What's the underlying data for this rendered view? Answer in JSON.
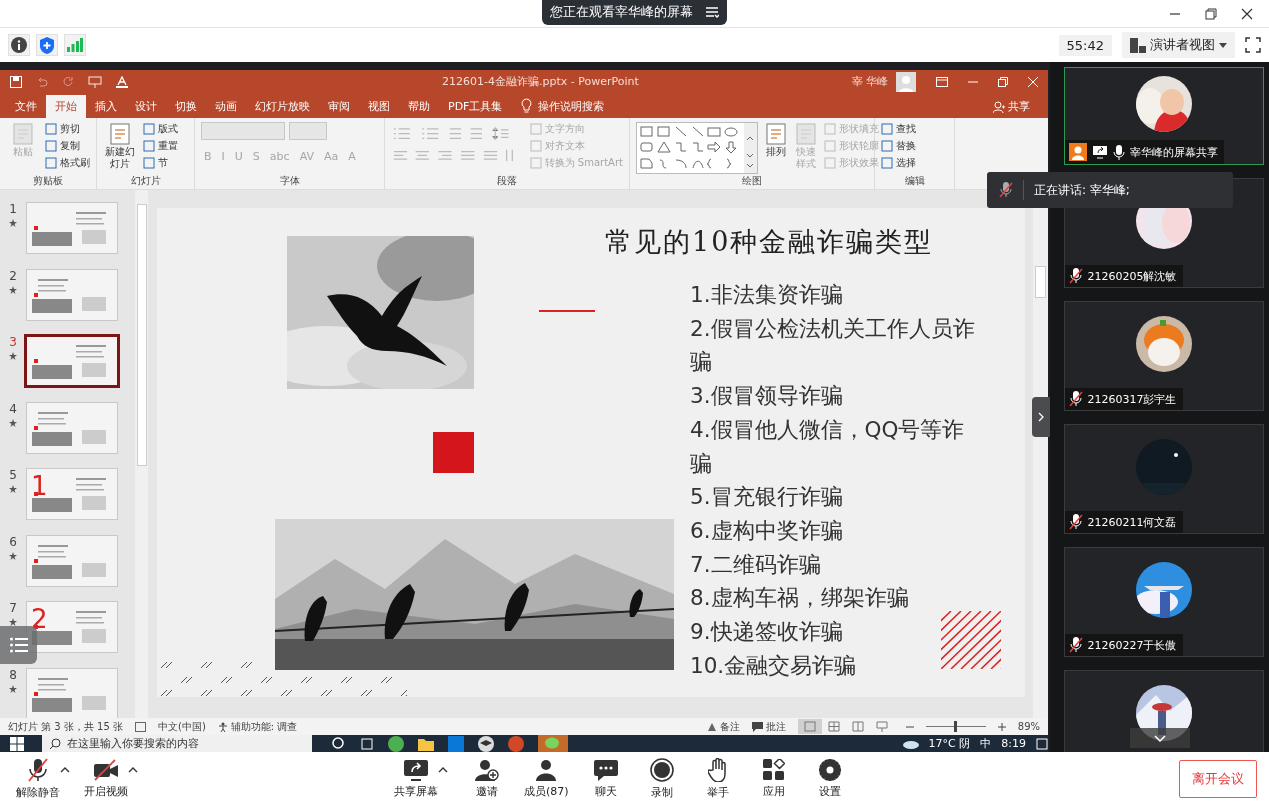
{
  "banner": {
    "text": "您正在观看宰华峰的屏幕"
  },
  "toolbar": {
    "timer": "55:42",
    "view_button": "演讲者视图"
  },
  "ppt": {
    "title": "212601-4金融诈骗.pptx  -  PowerPoint",
    "user": "宰 华峰",
    "tabs": [
      {
        "label": "文件",
        "selected": false
      },
      {
        "label": "开始",
        "selected": true
      },
      {
        "label": "插入",
        "selected": false
      },
      {
        "label": "设计",
        "selected": false
      },
      {
        "label": "切换",
        "selected": false
      },
      {
        "label": "动画",
        "selected": false
      },
      {
        "label": "幻灯片放映",
        "selected": false
      },
      {
        "label": "审阅",
        "selected": false
      },
      {
        "label": "视图",
        "selected": false
      },
      {
        "label": "帮助",
        "selected": false
      },
      {
        "label": "PDF工具集",
        "selected": false
      }
    ],
    "search_hint": "操作说明搜索",
    "share": "共享",
    "ribbon": [
      {
        "label": "剪贴板",
        "kind": "clipboard",
        "items": [
          {
            "label": "粘贴",
            "disabled": true
          },
          {
            "label": "剪切",
            "disabled": false
          },
          {
            "label": "复制",
            "disabled": false
          },
          {
            "label": "格式刷",
            "disabled": false
          }
        ]
      },
      {
        "label": "幻灯片",
        "kind": "slides",
        "items": [
          {
            "label": "新建幻灯片",
            "disabled": false
          },
          {
            "label": "版式",
            "disabled": false
          },
          {
            "label": "重置",
            "disabled": false
          },
          {
            "label": "节",
            "disabled": false
          }
        ]
      },
      {
        "label": "字体",
        "kind": "font",
        "items": [
          {
            "label": "B",
            "disabled": true
          },
          {
            "label": "I",
            "disabled": true
          },
          {
            "label": "U",
            "disabled": true
          },
          {
            "label": "S",
            "disabled": true
          },
          {
            "label": "abc",
            "disabled": true
          },
          {
            "label": "AV",
            "disabled": true
          },
          {
            "label": "Aa",
            "disabled": true
          },
          {
            "label": "A",
            "disabled": true
          }
        ]
      },
      {
        "label": "段落",
        "kind": "paragraph",
        "items": [
          {
            "label": "文字方向",
            "disabled": true
          },
          {
            "label": "对齐文本",
            "disabled": true
          },
          {
            "label": "转换为 SmartArt",
            "disabled": true
          }
        ]
      },
      {
        "label": "绘图",
        "kind": "drawing",
        "items": [
          {
            "label": "排列",
            "disabled": false
          },
          {
            "label": "快速样式",
            "disabled": true
          },
          {
            "label": "形状填充",
            "disabled": true
          },
          {
            "label": "形状轮廓",
            "disabled": true
          },
          {
            "label": "形状效果",
            "disabled": true
          }
        ]
      },
      {
        "label": "编辑",
        "kind": "editing",
        "items": [
          {
            "label": "查找",
            "disabled": false
          },
          {
            "label": "替换",
            "disabled": false
          },
          {
            "label": "选择",
            "disabled": false
          }
        ]
      }
    ],
    "thumbnails": [
      {
        "number": "1",
        "selected": false
      },
      {
        "number": "2",
        "selected": false
      },
      {
        "number": "3",
        "selected": true
      },
      {
        "number": "4",
        "selected": false
      },
      {
        "number": "5",
        "selected": false,
        "big_number": "1"
      },
      {
        "number": "6",
        "selected": false
      },
      {
        "number": "7",
        "selected": false,
        "big_number": "2"
      },
      {
        "number": "8",
        "selected": false
      }
    ],
    "slide": {
      "title": "常见的10种金融诈骗类型",
      "items": [
        "1.非法集资诈骗",
        "2.假冒公检法机关工作人员诈骗",
        "3.假冒领导诈骗",
        "4.假冒他人微信，QQ号等诈骗",
        "5.冒充银行诈骗",
        "6.虚构中奖诈骗",
        "7.二维码诈骗",
        "8.虚构车祸，绑架诈骗",
        "9.快递签收诈骗",
        "10.金融交易诈骗"
      ]
    },
    "status": {
      "slide_count": "幻灯片 第 3 张，共 15 张",
      "language": "中文(中国)",
      "accessibility": "辅助功能: 调查",
      "notes": "备注",
      "comments": "批注",
      "zoom": "89%",
      "level": 0.49
    }
  },
  "taskbar": {
    "search_placeholder": "在这里输入你要搜索的内容",
    "weather": "17°C 阴",
    "ime": "中",
    "time": "8:19"
  },
  "panel": {
    "share_tile": {
      "name": "宰华峰的屏幕共享"
    },
    "speaking": "正在讲话: 宰华峰;",
    "participants": [
      {
        "name": "21260205解沈敏",
        "muted": true
      },
      {
        "name": "21260317彭宇生",
        "muted": true
      },
      {
        "name": "21260211何文磊",
        "muted": true
      },
      {
        "name": "21260227于长傲",
        "muted": true
      }
    ]
  },
  "controls": [
    {
      "label": "解除静音",
      "kind": "mic",
      "caret": true
    },
    {
      "label": "开启视频",
      "kind": "video",
      "caret": true
    },
    {
      "label": "共享屏幕",
      "kind": "share",
      "caret": true
    },
    {
      "label": "邀请",
      "kind": "invite",
      "caret": false
    },
    {
      "label": "成员(87)",
      "kind": "members",
      "caret": false
    },
    {
      "label": "聊天",
      "kind": "chat",
      "caret": false
    },
    {
      "label": "录制",
      "kind": "record",
      "caret": false
    },
    {
      "label": "举手",
      "kind": "hand",
      "caret": false
    },
    {
      "label": "应用",
      "kind": "apps",
      "caret": false
    },
    {
      "label": "设置",
      "kind": "settings",
      "caret": false
    }
  ],
  "leave_button": "离开会议"
}
